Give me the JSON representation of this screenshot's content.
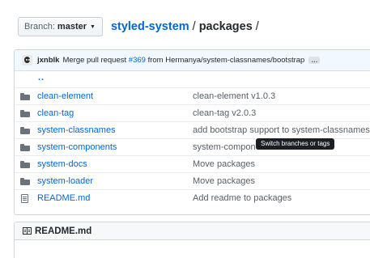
{
  "branch": {
    "prefix": "Branch:",
    "name": "master",
    "caret": "▼"
  },
  "breadcrumb": {
    "repo": "styled-system",
    "separator": "/",
    "current": "packages",
    "trailing": "/"
  },
  "commit": {
    "author": "jxnblk",
    "message_prefix": "Merge pull request",
    "pr_link": "#369",
    "message_suffix": "from Hermanya/system-classnames/bootstrap",
    "ellipsis": "…"
  },
  "files": {
    "up_dir": "..",
    "rows": [
      {
        "type": "dir",
        "name": "clean-element",
        "message": "clean-element v1.0.3"
      },
      {
        "type": "dir",
        "name": "clean-tag",
        "message": "clean-tag v2.0.3"
      },
      {
        "type": "dir",
        "name": "system-classnames",
        "message": "add bootstrap support to system-classnames"
      },
      {
        "type": "dir",
        "name": "system-components",
        "message": "system-components v3.0.3"
      },
      {
        "type": "dir",
        "name": "system-docs",
        "message": "Move packages"
      },
      {
        "type": "dir",
        "name": "system-loader",
        "message": "Move packages"
      },
      {
        "type": "file",
        "name": "README.md",
        "message": "Add readme to packages"
      }
    ]
  },
  "tooltip": "Switch branches or tags",
  "readme": {
    "title": "README.md"
  }
}
